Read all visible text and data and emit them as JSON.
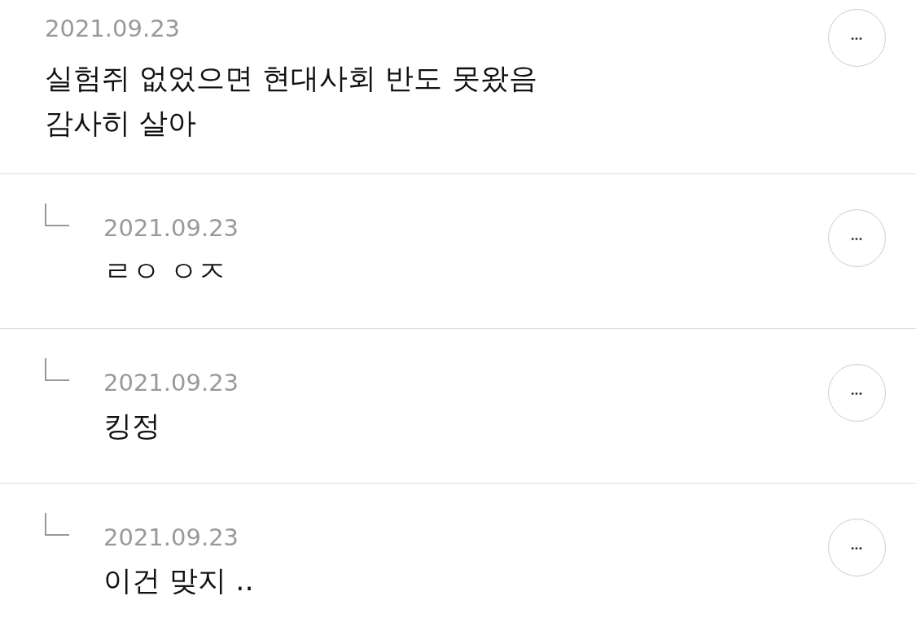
{
  "comment": {
    "date": "2021.09.23",
    "text": "실험쥐 없었으면 현대사회 반도 못왔음\n감사히 살아",
    "more": "•••"
  },
  "replies": [
    {
      "date": "2021.09.23",
      "text": "ㄹㅇ ㅇㅈ",
      "more": "•••"
    },
    {
      "date": "2021.09.23",
      "text": "킹정",
      "more": "•••"
    },
    {
      "date": "2021.09.23",
      "text": "이건 맞지 ..",
      "more": "•••"
    }
  ]
}
